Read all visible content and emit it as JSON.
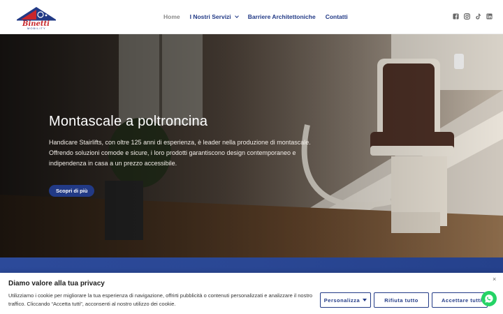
{
  "brand": {
    "name": "Binetti",
    "sub": "MOBILITY",
    "colors": {
      "primary": "#223a86",
      "accent": "#c8262b"
    }
  },
  "nav": {
    "items": [
      {
        "label": "Home",
        "active": true
      },
      {
        "label": "I Nostri Servizi",
        "has_dropdown": true
      },
      {
        "label": "Barriere Architettoniche"
      },
      {
        "label": "Contatti"
      }
    ]
  },
  "social": [
    "facebook-icon",
    "instagram-icon",
    "tiktok-icon",
    "linkedin-icon"
  ],
  "hero": {
    "title": "Montascale a poltroncina",
    "text": "Handicare Stairlifts, con oltre 125 anni di esperienza, è leader nella produzione di montascale. Offrendo soluzioni comode e sicure, i loro prodotti garantiscono design contemporaneo e indipendenza in casa a un prezzo accessibile.",
    "button_label": "Scopri di più"
  },
  "cookie": {
    "title": "Diamo valore alla tua privacy",
    "text": "Utilizziamo i cookie per migliorare la tua esperienza di navigazione, offrirti pubblicità o contenuti personalizzati e analizzare il nostro traffico. Cliccando “Accetta tutti”, acconsenti al nostro utilizzo dei cookie.",
    "close": "×",
    "customize_label": "Personalizza",
    "reject_label": "Rifiuta tutto",
    "accept_label": "Accettare tutti"
  }
}
